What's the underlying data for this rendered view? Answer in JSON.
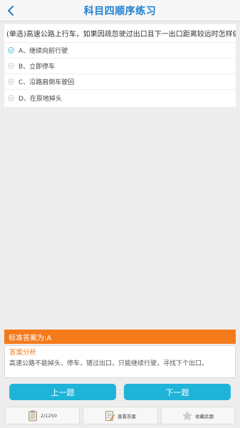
{
  "header": {
    "title": "科目四顺序练习",
    "back_icon": "back-chevron-icon"
  },
  "question": {
    "text": "(单选)高速公路上行车，如果因疏忽驶过出口且下一出口距离较远时怎样做?",
    "options": [
      {
        "label": "A、继续向前行驶",
        "state": "selected"
      },
      {
        "label": "B、立即停车",
        "state": "unselected"
      },
      {
        "label": "C、沿路肩倒车驶回",
        "state": "unselected"
      },
      {
        "label": "D、在原地掉头",
        "state": "unselected"
      }
    ]
  },
  "answer": {
    "label": "标准答案为:A"
  },
  "analysis": {
    "title": "答案分析",
    "text": "高速公路不能掉头、停车，错过出口，只能继续行驶，寻找下个出口。"
  },
  "navigation": {
    "prev_label": "上一题",
    "next_label": "下一题"
  },
  "toolbar": {
    "progress": "2/1250",
    "view_answer_label": "查看答案",
    "favorite_label": "收藏此题"
  },
  "colors": {
    "accent_blue": "#1e7fd0",
    "button_cyan": "#1fb3d8",
    "answer_orange": "#f57a1a",
    "background": "#ededed"
  }
}
